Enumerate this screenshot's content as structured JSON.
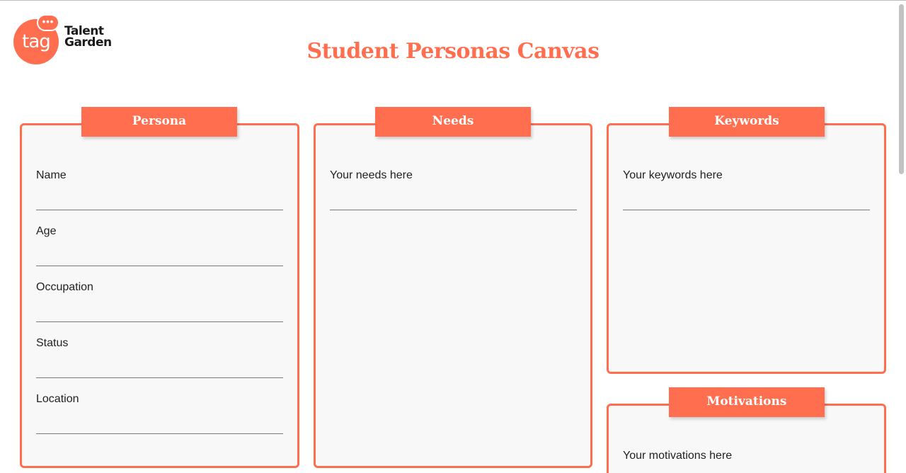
{
  "brand": {
    "logo_mark": "tag",
    "logo_bubble": "•••",
    "logo_line1": "Talent",
    "logo_line2": "Garden",
    "accent_color": "#ff6f4f"
  },
  "page": {
    "title": "Student Personas Canvas"
  },
  "panels": {
    "persona": {
      "title": "Persona",
      "fields": [
        "Name",
        "Age",
        "Occupation",
        "Status",
        "Location"
      ]
    },
    "needs": {
      "title": "Needs",
      "placeholder": "Your needs here"
    },
    "keywords": {
      "title": "Keywords",
      "placeholder": "Your keywords here"
    },
    "motivations": {
      "title": "Motivations",
      "placeholder": "Your motivations here"
    }
  }
}
